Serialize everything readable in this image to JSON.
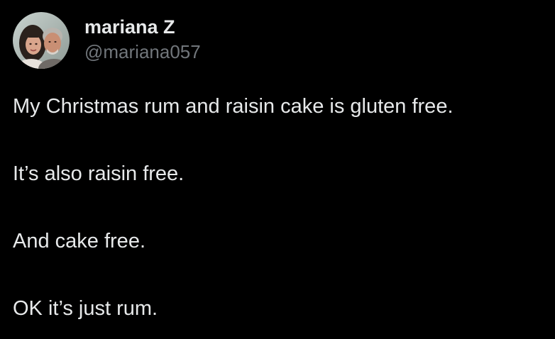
{
  "author": {
    "display_name": "mariana Z",
    "handle": "@mariana057",
    "avatar_icon": "profile-photo"
  },
  "tweet": {
    "lines": [
      "My Christmas rum and raisin cake is gluten free.",
      "It’s also raisin free.",
      "And cake free.",
      "OK it’s just rum."
    ]
  },
  "colors": {
    "background": "#000000",
    "primary_text": "#e7e9ea",
    "secondary_text": "#71767b"
  }
}
